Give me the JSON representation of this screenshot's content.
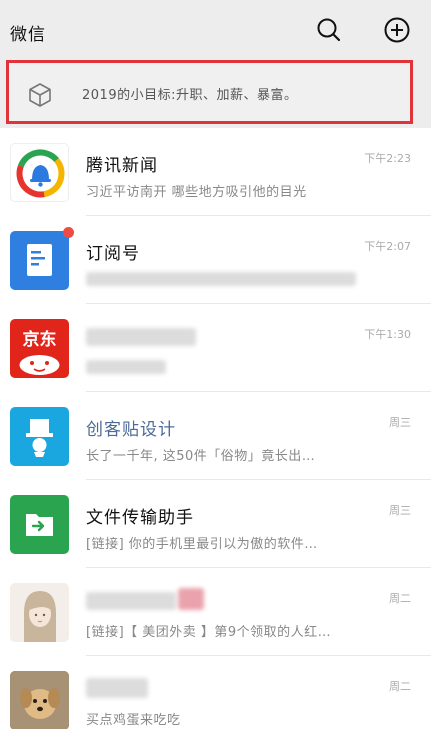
{
  "header": {
    "title": "微信",
    "search_icon": "search-icon",
    "add_icon": "plus-circle-icon"
  },
  "pinned": {
    "icon": "cube-icon",
    "text": "2019的小目标:升职、加薪、暴富。",
    "highlight_color": "#e0343a"
  },
  "chats": [
    {
      "name": "腾讯新闻",
      "preview": "习近平访南开 哪些地方吸引他的目光",
      "time": "下午2:23",
      "avatar": "tencent-news-logo"
    },
    {
      "name": "订阅号",
      "preview": "",
      "time": "下午2:07",
      "avatar": "subscription-icon",
      "unread_dot": true
    },
    {
      "name": "",
      "preview": "",
      "time": "下午1:30",
      "avatar": "jd-logo"
    },
    {
      "name": "创客贴设计",
      "preview": "长了一千年, 这50件「俗物」竟长出…",
      "time": "周三",
      "avatar": "chuangketie-logo"
    },
    {
      "name": "文件传输助手",
      "preview": "[链接] 你的手机里最引以为傲的软件…",
      "time": "周三",
      "avatar": "file-transfer-icon"
    },
    {
      "name": "",
      "preview": "[链接]【 美团外卖 】第9个领取的人红…",
      "time": "周二",
      "avatar": "girl-avatar"
    },
    {
      "name": "",
      "preview": "买点鸡蛋来吃吃",
      "time": "周二",
      "avatar": "dog-avatar"
    }
  ],
  "colors": {
    "header_bg": "#ededed",
    "accent_red": "#e0343a",
    "wechat_green": "#2aa44f",
    "link_blue": "#4b6a99"
  }
}
